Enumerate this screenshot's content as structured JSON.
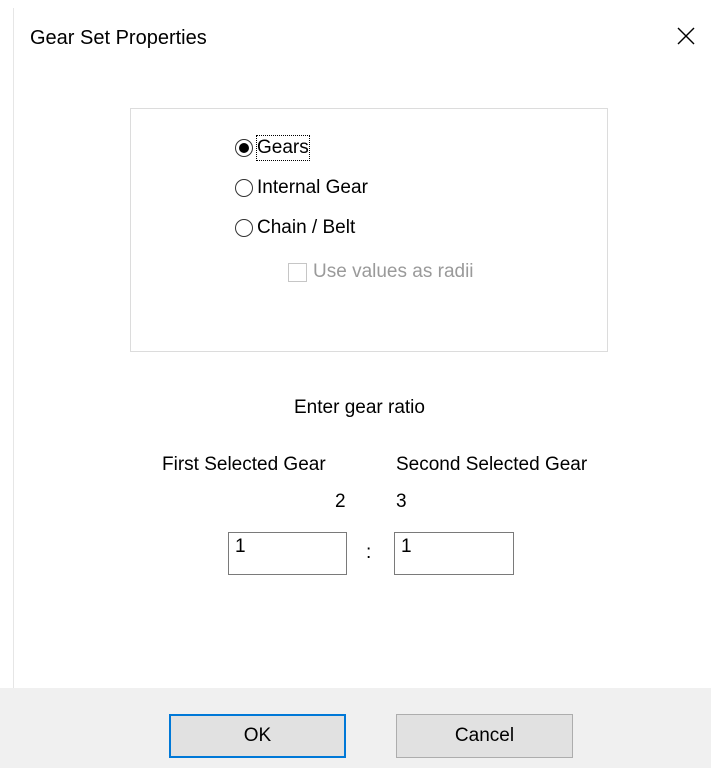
{
  "dialog": {
    "title": "Gear Set Properties",
    "close_icon": "close-icon"
  },
  "gear_type": {
    "options": [
      {
        "label": "Gears",
        "selected": true
      },
      {
        "label": "Internal Gear",
        "selected": false
      },
      {
        "label": "Chain / Belt",
        "selected": false
      }
    ],
    "use_radii": {
      "label": "Use values as radii",
      "checked": false,
      "enabled": false
    }
  },
  "ratio": {
    "prompt": "Enter gear ratio",
    "first_header": "First Selected Gear",
    "second_header": "Second Selected Gear",
    "first_gear_number": "2",
    "second_gear_number": "3",
    "first_value": "1",
    "separator": ":",
    "second_value": "1"
  },
  "buttons": {
    "ok_label": "OK",
    "cancel_label": "Cancel"
  },
  "colors": {
    "accent": "#0078d7",
    "footer_bg": "#f0f0f0",
    "disabled_text": "#9a9a9a"
  }
}
